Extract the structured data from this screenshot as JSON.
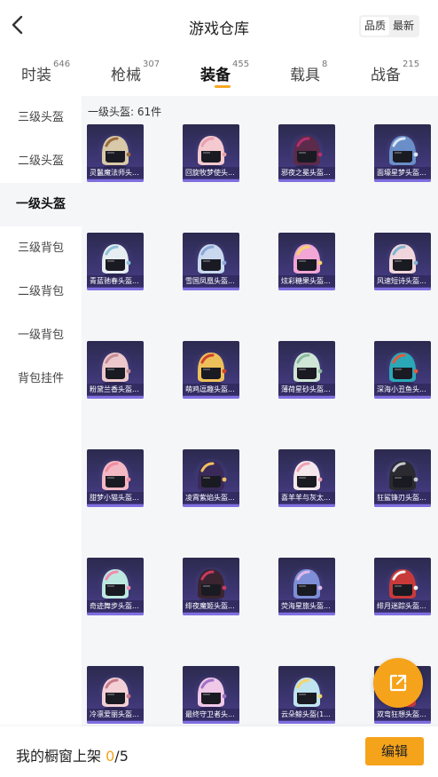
{
  "header": {
    "title": "游戏仓库",
    "back_icon": "chevron-left-icon",
    "sort_options": [
      "品质",
      "最新"
    ],
    "sort_selected": "品质"
  },
  "tabs": [
    {
      "label": "时装",
      "count": "646",
      "active": false
    },
    {
      "label": "枪械",
      "count": "307",
      "active": false
    },
    {
      "label": "装备",
      "count": "455",
      "active": true
    },
    {
      "label": "载具",
      "count": "8",
      "active": false
    },
    {
      "label": "战备",
      "count": "215",
      "active": false
    }
  ],
  "sidebar": {
    "items": [
      {
        "label": "三级头盔",
        "active": false
      },
      {
        "label": "二级头盔",
        "active": false
      },
      {
        "label": "一级头盔",
        "active": true
      },
      {
        "label": "三级背包",
        "active": false
      },
      {
        "label": "二级背包",
        "active": false
      },
      {
        "label": "一级背包",
        "active": false
      },
      {
        "label": "背包挂件",
        "active": false
      }
    ]
  },
  "section": {
    "title": "一级头盔: 61件"
  },
  "items": [
    {
      "name": "灵鬣魔法师头...",
      "shell": "#d8c9a8",
      "accent": "#9b6a3c"
    },
    {
      "name": "回旋牧梦使头...",
      "shell": "#f4c9cf",
      "accent": "#e8a0b0"
    },
    {
      "name": "邪夜之冕头盔...",
      "shell": "#5c2a4a",
      "accent": "#b03070"
    },
    {
      "name": "面壕星梦头盔...",
      "shell": "#6a8ec8",
      "accent": "#dce6f5"
    },
    {
      "name": "青蓝驰春头盔...",
      "shell": "#e6eef2",
      "accent": "#8cc0d8"
    },
    {
      "name": "雪国凤凰头盔...",
      "shell": "#c9d8ee",
      "accent": "#8aa6d8"
    },
    {
      "name": "炫彩糖果头盔...",
      "shell": "#f2a6d6",
      "accent": "#f5d56a"
    },
    {
      "name": "风速短诗头盔...",
      "shell": "#f0d6dc",
      "accent": "#7fb4d0"
    },
    {
      "name": "粉黛兰香头盔...",
      "shell": "#ecc8cc",
      "accent": "#c48c94"
    },
    {
      "name": "萌鸡逗趣头盔...",
      "shell": "#eec05a",
      "accent": "#d0402c"
    },
    {
      "name": "薄荷星砂头盔...",
      "shell": "#cfe6d6",
      "accent": "#8ab8a0"
    },
    {
      "name": "深海小丑鱼头...",
      "shell": "#2aa8b8",
      "accent": "#e25a3a"
    },
    {
      "name": "甜梦小猫头盔...",
      "shell": "#f4b8c4",
      "accent": "#f08ca0"
    },
    {
      "name": "凌霄紫焰头盔...",
      "shell": "#3a2a5a",
      "accent": "#f2c060"
    },
    {
      "name": "喜羊羊与灰太...",
      "shell": "#f4e8ec",
      "accent": "#f0a0b8"
    },
    {
      "name": "狂鲨锋刃头盔...",
      "shell": "#2a2a30",
      "accent": "#c8c8d0"
    },
    {
      "name": "奇迹舞步头盔...",
      "shell": "#bde8e0",
      "accent": "#f28ab0"
    },
    {
      "name": "绯夜魔姬头盔...",
      "shell": "#3a2430",
      "accent": "#c83a60"
    },
    {
      "name": "荧海星旅头盔...",
      "shell": "#7e8fd8",
      "accent": "#e2b8e8"
    },
    {
      "name": "绯月迷踪头盔...",
      "shell": "#c83a3a",
      "accent": "#f2f2f2"
    },
    {
      "name": "冷凛爱丽头盔...",
      "shell": "#f2d0d6",
      "accent": "#c87888"
    },
    {
      "name": "最终守卫者头...",
      "shell": "#f0c8e8",
      "accent": "#a070c8"
    },
    {
      "name": "云朵鲸头盔(1...",
      "shell": "#bfe4f0",
      "accent": "#f5d56a"
    },
    {
      "name": "双弯狂想头盔...",
      "shell": "#d83a4a",
      "accent": "#f2f2f2"
    }
  ],
  "share_button": {
    "icon": "share-external-icon"
  },
  "bottom_bar": {
    "shelf_label": "我的橱窗上架",
    "shelf_count": "0",
    "shelf_total": "/5",
    "edit_label": "编辑"
  },
  "colors": {
    "accent": "#f5a31b",
    "card_bg": "#3b3570",
    "content_bg": "#f5f6f8"
  }
}
